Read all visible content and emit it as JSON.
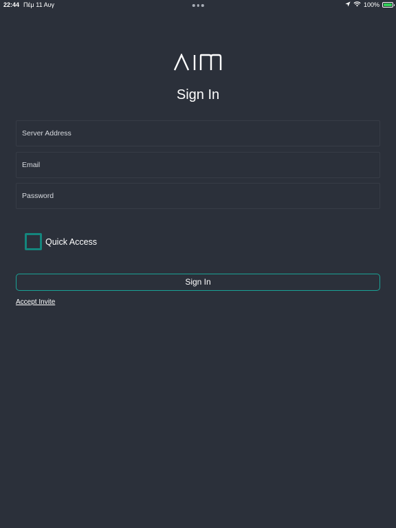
{
  "status_bar": {
    "time": "22:44",
    "date": "Πέμ 11 Αυγ",
    "battery_percent": "100%",
    "battery_level": 1.0,
    "icons": [
      "location-arrow-icon",
      "wifi-icon",
      "battery-charging-icon"
    ]
  },
  "app": {
    "logo": "AIM",
    "title": "Sign In"
  },
  "form": {
    "server_placeholder": "Server Address",
    "email_placeholder": "Email",
    "password_placeholder": "Password",
    "server_value": "",
    "email_value": "",
    "password_value": "",
    "quick_access_label": "Quick Access",
    "quick_access_checked": false,
    "sign_in_label": "Sign In",
    "accept_invite_label": "Accept Invite"
  },
  "colors": {
    "background": "#2b303a",
    "accent": "#1aa396",
    "checkbox_border": "#14867d"
  }
}
